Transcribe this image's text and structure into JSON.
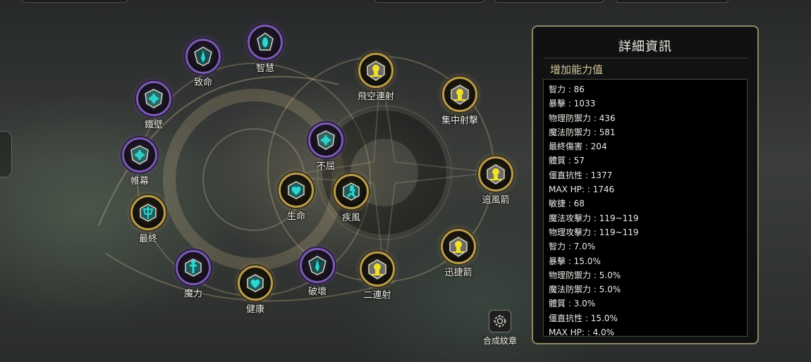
{
  "panel": {
    "title": "詳細資訊",
    "subtitle": "增加能力值",
    "stats": [
      "智力 : 86",
      "暴擊 : 1033",
      "物理防禦力 : 436",
      "魔法防禦力 : 581",
      "最終傷害 : 204",
      "體質 : 57",
      "僵直抗性 : 1377",
      "MAX HP:  : 1746",
      "敏捷 : 68",
      "魔法攻擊力 : 119~119",
      "物理攻擊力 : 119~119",
      "智力 : 7.0%",
      "暴擊 : 15.0%",
      "物理防禦力 : 5.0%",
      "魔法防禦力 : 5.0%",
      "體質 : 3.0%",
      "僵直抗性 : 15.0%",
      "MAX HP:  : 4.0%"
    ]
  },
  "synth": {
    "label": "合成紋章"
  },
  "nodes": [
    {
      "id": "zhiming",
      "label": "致命",
      "type": "purple",
      "icon": "sword-crest-icon"
    },
    {
      "id": "zhihui",
      "label": "智慧",
      "type": "purple",
      "icon": "orb-crest-icon"
    },
    {
      "id": "tiebi",
      "label": "鐵壁",
      "type": "purple",
      "icon": "shield-crest-icon"
    },
    {
      "id": "weimu",
      "label": "帷幕",
      "type": "purple",
      "icon": "shield-crest-icon"
    },
    {
      "id": "zuizhong",
      "label": "最終",
      "type": "gold",
      "icon": "axe-crest-icon"
    },
    {
      "id": "moli",
      "label": "魔力",
      "type": "purple",
      "icon": "wand-crest-icon"
    },
    {
      "id": "jiankang",
      "label": "健康",
      "type": "gold",
      "icon": "heart-crest-icon"
    },
    {
      "id": "pohuai",
      "label": "破壞",
      "type": "purple",
      "icon": "sword-crest-icon"
    },
    {
      "id": "buqu",
      "label": "不屈",
      "type": "purple",
      "icon": "shield-crest-icon"
    },
    {
      "id": "shengming",
      "label": "生命",
      "type": "gold",
      "icon": "heart-crest-icon"
    },
    {
      "id": "jifeng",
      "label": "疾風",
      "type": "gold",
      "icon": "runner-crest-icon"
    },
    {
      "id": "feikong",
      "label": "飛空連射",
      "type": "gold",
      "icon": "skull-crest-icon"
    },
    {
      "id": "jizhong",
      "label": "集中射擊",
      "type": "gold",
      "icon": "skull-crest-icon"
    },
    {
      "id": "zhuifeng",
      "label": "追風箭",
      "type": "gold",
      "icon": "skull-crest-icon"
    },
    {
      "id": "xunjie",
      "label": "迅捷箭",
      "type": "gold",
      "icon": "skull-crest-icon"
    },
    {
      "id": "erlian",
      "label": "二連射",
      "type": "gold",
      "icon": "skull-crest-icon"
    }
  ],
  "colors": {
    "teal": "#2fd6d0",
    "yellow": "#f1e02a",
    "purple_ring": "#7b5ab3",
    "gold_ring": "#b99c4b"
  }
}
